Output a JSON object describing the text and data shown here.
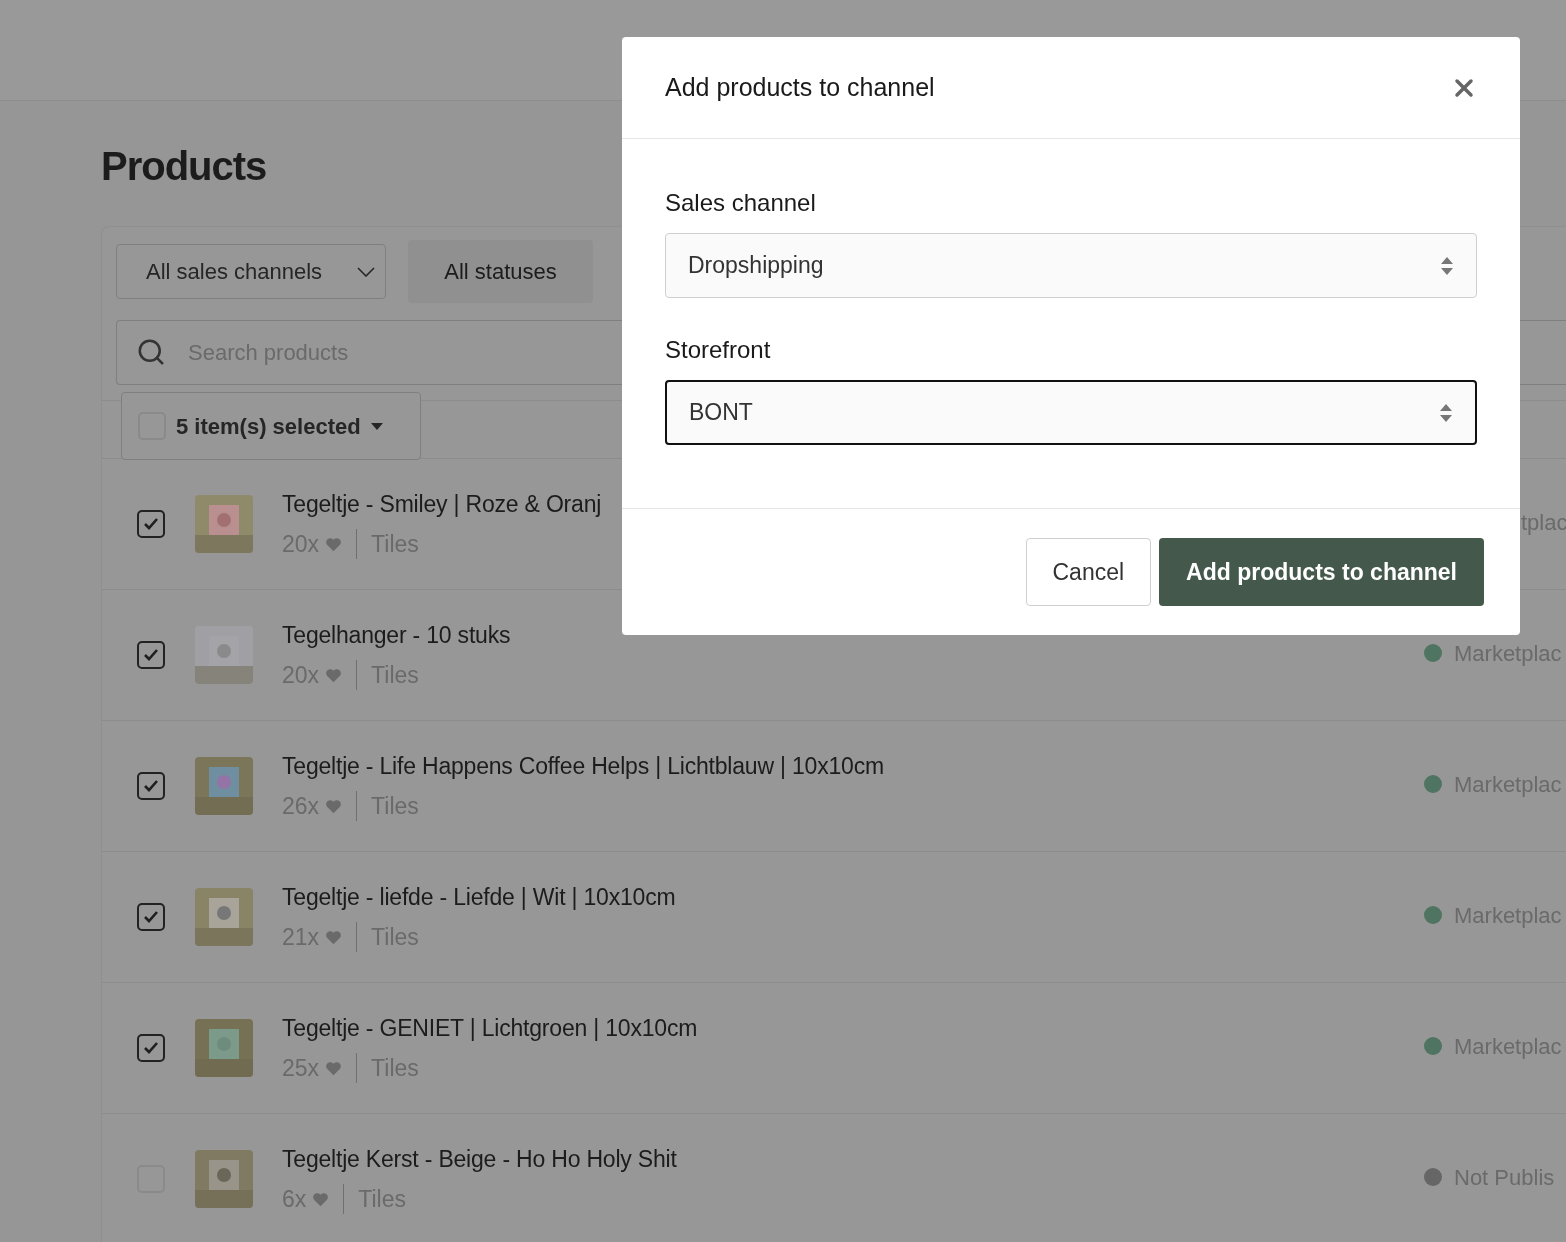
{
  "page": {
    "title": "Products"
  },
  "filters": {
    "sales_channel": "All sales channels",
    "status": "All statuses"
  },
  "search": {
    "placeholder": "Search products"
  },
  "bulk": {
    "label": "5 item(s) selected",
    "checked": false
  },
  "products": [
    {
      "name": "Tegeltje - Smiley | Roze & Oranj",
      "checked": true,
      "count": "20x",
      "category": "Tiles",
      "status": {
        "kind": "partial",
        "label": "tplac"
      }
    },
    {
      "name": "Tegelhanger - 10 stuks",
      "checked": true,
      "count": "20x",
      "category": "Tiles",
      "status": {
        "kind": "full",
        "label": "Marketplac",
        "color": "#4f7462"
      }
    },
    {
      "name": "Tegeltje - Life Happens Coffee Helps | Lichtblauw | 10x10cm",
      "checked": true,
      "count": "26x",
      "category": "Tiles",
      "status": {
        "kind": "full",
        "label": "Marketplac",
        "color": "#4f7462"
      }
    },
    {
      "name": "Tegeltje - liefde - Liefde | Wit | 10x10cm",
      "checked": true,
      "count": "21x",
      "category": "Tiles",
      "status": {
        "kind": "full",
        "label": "Marketplac",
        "color": "#4f7462"
      }
    },
    {
      "name": "Tegeltje - GENIET | Lichtgroen | 10x10cm",
      "checked": true,
      "count": "25x",
      "category": "Tiles",
      "status": {
        "kind": "full",
        "label": "Marketplac",
        "color": "#4f7462"
      }
    },
    {
      "name": "Tegeltje Kerst - Beige - Ho Ho Holy Shit",
      "checked": false,
      "count": "6x",
      "category": "Tiles",
      "status": {
        "kind": "full",
        "label": "Not Publis",
        "color": "#666666"
      }
    }
  ],
  "modal": {
    "title": "Add products to channel",
    "fields": [
      {
        "label": "Sales channel",
        "value": "Dropshipping",
        "focused": false
      },
      {
        "label": "Storefront",
        "value": "BONT",
        "focused": true
      }
    ],
    "buttons": [
      {
        "kind": "secondary",
        "label": "Cancel"
      },
      {
        "kind": "primary",
        "label": "Add products to channel"
      }
    ]
  }
}
